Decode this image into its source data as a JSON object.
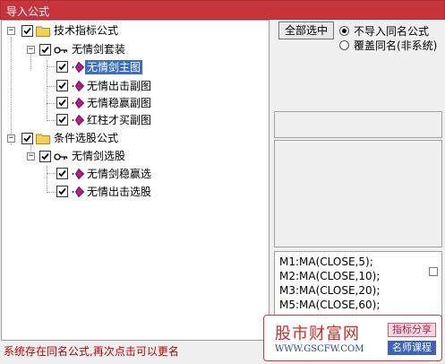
{
  "window": {
    "title": "导入公式"
  },
  "tree": {
    "nodes": [
      {
        "label": "技术指标公式",
        "kind": "folder",
        "expander": "−",
        "checked": true
      },
      {
        "label": "无情剑套装",
        "kind": "set",
        "expander": "−",
        "checked": true
      },
      {
        "label": "无情剑主图",
        "kind": "formula",
        "checked": true,
        "selected": true
      },
      {
        "label": "无情出击副图",
        "kind": "formula",
        "checked": true
      },
      {
        "label": "无情稳赢副图",
        "kind": "formula",
        "checked": true
      },
      {
        "label": "红柱才买副图",
        "kind": "formula",
        "checked": true
      },
      {
        "label": "条件选股公式",
        "kind": "folder",
        "expander": "−",
        "checked": true
      },
      {
        "label": "无情剑选股",
        "kind": "set",
        "expander": "−",
        "checked": true
      },
      {
        "label": "无情剑稳赢选",
        "kind": "formula",
        "checked": true
      },
      {
        "label": "无情出击选股",
        "kind": "formula",
        "checked": true
      }
    ]
  },
  "buttons": {
    "select_all": "全部选中"
  },
  "options": [
    {
      "label": "不导入同名公式",
      "checked": true
    },
    {
      "label": "覆盖同名(非系统)",
      "checked": false
    }
  ],
  "code_lines": [
    "M1:MA(CLOSE,5);",
    "M2:MA(CLOSE,10);",
    "M3:MA(CLOSE,20);",
    "M5:MA(CLOSE,60);"
  ],
  "status": "系统存在同名公式,再次点击可以更名",
  "watermark": {
    "site_name": "股市财富网",
    "url": "WWW.GSCFW.COM",
    "tag1": "指标分享",
    "tag2": "名师课程"
  },
  "colors": {
    "titlebar": "#c7353c",
    "selection": "#3b6fc4",
    "status_text": "#c00000",
    "folder": "#f2d05a",
    "formula_icon": "#b0208a"
  }
}
